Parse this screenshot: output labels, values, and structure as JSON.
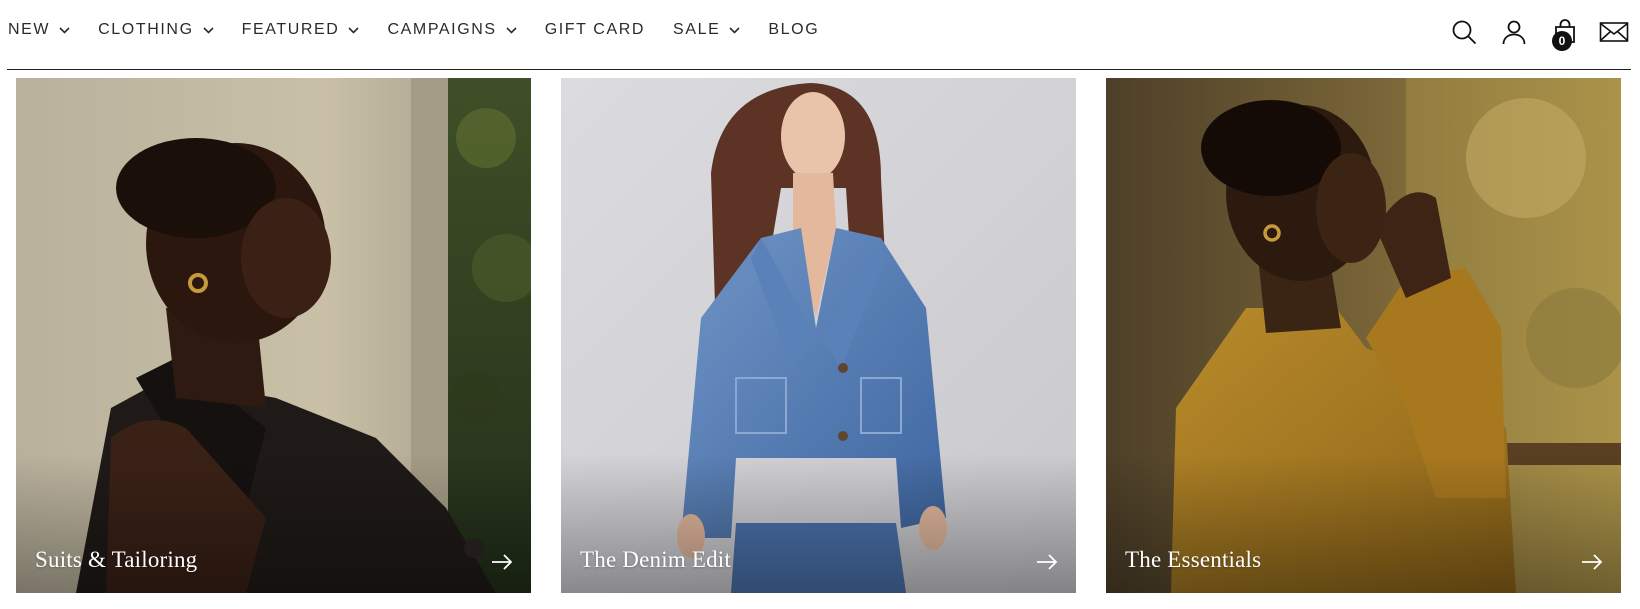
{
  "nav": {
    "items": [
      {
        "label": "NEW",
        "has_dropdown": true
      },
      {
        "label": "CLOTHING",
        "has_dropdown": true
      },
      {
        "label": "FEATURED",
        "has_dropdown": true
      },
      {
        "label": "CAMPAIGNS",
        "has_dropdown": true
      },
      {
        "label": "GIFT CARD",
        "has_dropdown": false
      },
      {
        "label": "SALE",
        "has_dropdown": true
      },
      {
        "label": "BLOG",
        "has_dropdown": false
      }
    ]
  },
  "header_icons": {
    "search": "search-icon",
    "account": "user-icon",
    "cart": "shopping-bag-icon",
    "cart_count": "0",
    "contact": "mail-icon"
  },
  "cards": [
    {
      "title": "Suits & Tailoring",
      "image": "woman-black-blazer-photo"
    },
    {
      "title": "The Denim Edit",
      "image": "woman-denim-jacket-photo"
    },
    {
      "title": "The Essentials",
      "image": "woman-mustard-sweater-photo"
    }
  ],
  "colors": {
    "text": "#2b2b2b",
    "divider": "#1e1e1e",
    "overlay_text": "#ffffff"
  }
}
